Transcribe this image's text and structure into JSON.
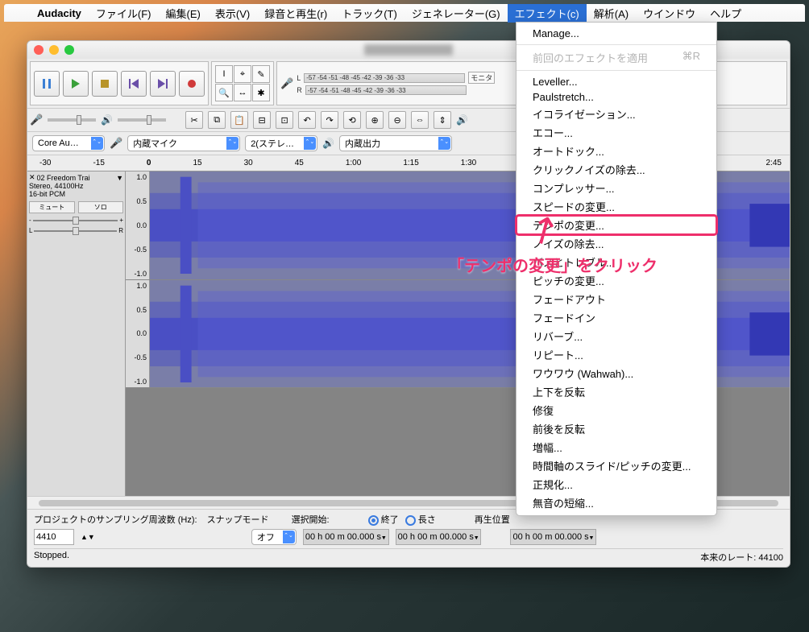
{
  "menubar": {
    "app": "Audacity",
    "items": [
      "ファイル(F)",
      "編集(E)",
      "表示(V)",
      "録音と再生(r)",
      "トラック(T)",
      "ジェネレーター(G)",
      "エフェクト(c)",
      "解析(A)",
      "ウインドウ",
      "ヘルプ"
    ],
    "active_index": 6
  },
  "meters": {
    "ticks": "-57 -54 -51 -48 -45 -42 -39 -36 -33",
    "monitor": "モニタ",
    "l": "L",
    "r": "R"
  },
  "device_bar": {
    "host": "Core Au…",
    "input": "内蔵マイク",
    "channels": "2(ステレ…",
    "output": "内蔵出力"
  },
  "ruler": [
    "-30",
    "-15",
    "0",
    "15",
    "30",
    "45",
    "1:00",
    "1:15",
    "1:30",
    "2:45"
  ],
  "track": {
    "name": "02 Freedom Trai",
    "info1": "Stereo, 44100Hz",
    "info2": "16-bit PCM",
    "mute": "ミュート",
    "solo": "ソロ",
    "l": "L",
    "r": "R",
    "minus": "-",
    "plus": "+",
    "scale": [
      "1.0",
      "0.5",
      "0.0",
      "-0.5",
      "-1.0"
    ]
  },
  "status": {
    "sample_rate_label": "プロジェクトのサンプリング周波数 (Hz):",
    "sample_rate": "4410",
    "snap_label": "スナップモード",
    "snap_value": "オフ",
    "sel_start": "選択開始:",
    "end": "終了",
    "length": "長さ",
    "time_zero": "00 h 00 m 00.000 s",
    "playback": "再生位置",
    "stopped": "Stopped.",
    "actual_rate": "本来のレート: 44100"
  },
  "effect_menu": {
    "manage": "Manage...",
    "repeat_last": "前回のエフェクトを適用",
    "shortcut": "⌘R",
    "items": [
      "Leveller...",
      "Paulstretch...",
      "イコライゼーション...",
      "エコー...",
      "オートドック...",
      "クリックノイズの除去...",
      "コンプレッサー...",
      "スピードの変更...",
      "テンポの変更...",
      "ノイズの除去...",
      "バスとトレブル...",
      "ピッチの変更...",
      "フェードアウト",
      "フェードイン",
      "リバーブ...",
      "リピート...",
      "ワウワウ (Wahwah)...",
      "上下を反転",
      "修復",
      "前後を反転",
      "増幅...",
      "時間軸のスライド/ピッチの変更...",
      "正規化...",
      "無音の短縮..."
    ],
    "highlight_index": 8
  },
  "annotation": "「テンポの変更」をクリック"
}
